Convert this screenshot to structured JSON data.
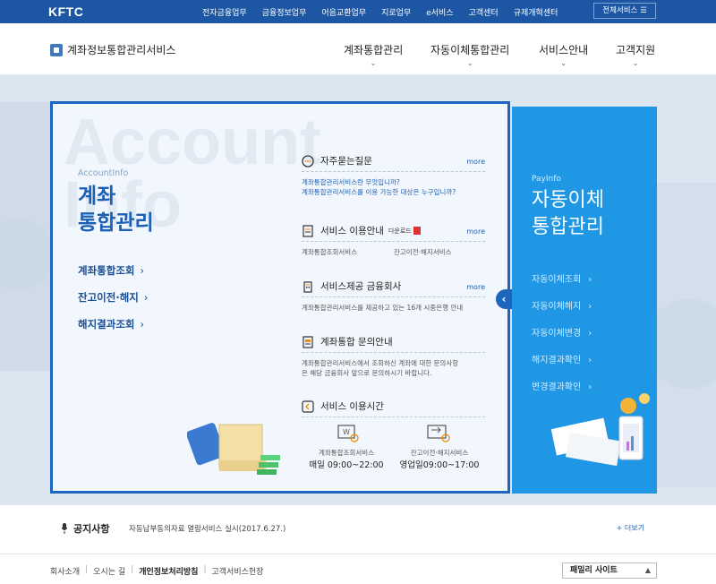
{
  "topbar": {
    "logo": "KFTC",
    "links": [
      "전자금융업무",
      "금융정보업무",
      "어음교환업무",
      "지로업무",
      "e서비스",
      "고객센터",
      "규제개혁센터"
    ],
    "all_services": "전체서비스 ☰"
  },
  "header": {
    "site_title": "계좌정보통합관리서비스",
    "nav": [
      "계좌통합관리",
      "자동이체통합관리",
      "서비스안내",
      "고객지원"
    ],
    "nav_chevron": "⌄"
  },
  "account_info": {
    "bg_text": [
      "Account",
      "Info"
    ],
    "subtitle": "AccountInfo",
    "title_line1": "계좌",
    "title_line2": "통합관리",
    "links": [
      "계좌통합조회",
      "잔고이전·해지",
      "해지결과조회"
    ],
    "arrow": "›"
  },
  "sections": {
    "faq": {
      "title": "자주묻는질문",
      "more": "more",
      "items": [
        "계좌통합관리서비스란 무엇입니까?",
        "계좌통합관리서비스를 이용 가능한 대상은 누구입니까?"
      ]
    },
    "usage_guide": {
      "title": "서비스 이용안내",
      "download": "다운로드",
      "more": "more",
      "items": [
        "계좌통합조회서비스",
        "잔고이전·해지서비스"
      ]
    },
    "institutions": {
      "title": "서비스제공 금융회사",
      "more": "more",
      "text": "계좌통합관리서비스를 제공하고 있는 16개 시중은행 안내"
    },
    "inquiry": {
      "title": "계좌통합 문의안내",
      "text1": "계좌통합관리서비스에서 조회하신 계좌에 대한 문의사항",
      "text2": "은 해당 금융회사 앞으로 문의하시기 바랍니다."
    },
    "hours": {
      "title": "서비스 이용시간",
      "svc1_name": "계좌통합조회서비스",
      "svc1_time": "매일 09:00~22:00",
      "svc2_name": "잔고이전·해지서비스",
      "svc2_time": "영업일09:00~17:00"
    }
  },
  "pay_info": {
    "subtitle": "PayInfo",
    "title_line1": "자동이체",
    "title_line2": "통합관리",
    "links": [
      "자동이체조회",
      "자동이체해지",
      "자동이체변경",
      "해지결과확인",
      "변경결과확인"
    ],
    "arrow": "›"
  },
  "toggle_icon": "‹",
  "notice": {
    "label": "공지사항",
    "text": "자동납부동의자료 열람서비스 실시(2017.6.27.)",
    "more": "+ 더보기"
  },
  "footer": {
    "links": [
      "회사소개",
      "오시는 길",
      "개인정보처리방침",
      "고객서비스헌장"
    ],
    "family_site": "패밀리 사이트",
    "family_icon": "▲"
  },
  "colors": {
    "brand_blue": "#1d57a3",
    "panel_border": "#1e66bd",
    "pay_blue": "#1f97e5"
  }
}
